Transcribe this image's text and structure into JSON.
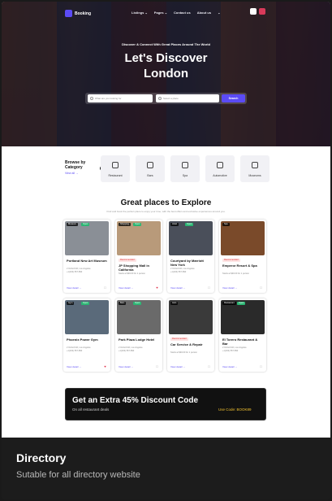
{
  "nav": {
    "logo": "Booking",
    "menu": [
      "Listings ⌄",
      "Pages ⌄",
      "Contact us",
      "About us",
      "⌄"
    ]
  },
  "hero": {
    "subtitle": "Discover & Connect With Great Places Around The World",
    "title_line1": "Let's Discover",
    "title_line2": "London",
    "search_placeholder": "What are you looking for",
    "location_placeholder": "Select a place",
    "search_button": "Search"
  },
  "categories": {
    "title": "Browse by Category",
    "link": "View all →",
    "items": [
      "Restaurant",
      "Bars",
      "Spa",
      "Automotive",
      "Museums"
    ]
  },
  "section": {
    "title": "Great places to Explore",
    "subtitle": "Find and book the perfect place to enjoy your time, with the best offers and exclusive experiences around you."
  },
  "cards": [
    {
      "category": "Museum",
      "status": "Open",
      "recommended": "",
      "name": "Portland New Art Museum",
      "meta1": "2 Oxford Rd, Los Angeles",
      "meta2": "+1(234) 567-890",
      "foot": "View detail →",
      "fav": false,
      "img": "#8a8f96"
    },
    {
      "category": "Shopping",
      "status": "Open",
      "recommended": "Recommended",
      "name": "JP Shopping Mall in California",
      "meta1": "Starts at $49.00 for 1 person",
      "meta2": "",
      "foot": "View detail →",
      "fav": true,
      "img": "#b89a7a"
    },
    {
      "category": "Hotel",
      "status": "Open",
      "recommended": "",
      "name": "Courtyard by Marriott New York",
      "meta1": "2 Oxford Rd, Los Angeles",
      "meta2": "+1(234) 567-890",
      "foot": "View detail →",
      "fav": false,
      "img": "#4a4f5a"
    },
    {
      "category": "Spa",
      "status": "",
      "recommended": "Recommended",
      "name": "Emperor Resort & Spa",
      "meta1": "Starts at $49.00 for 1 person",
      "meta2": "",
      "foot": "View detail →",
      "fav": false,
      "img": "#7a4a2a"
    },
    {
      "category": "Gym",
      "status": "Open",
      "recommended": "",
      "name": "Phoenix Power Gym",
      "meta1": "2 Oxford Rd, Los Angeles",
      "meta2": "+1(234) 567-890",
      "foot": "View detail →",
      "fav": true,
      "img": "#5a6a7a"
    },
    {
      "category": "Bars",
      "status": "Open",
      "recommended": "",
      "name": "Park Plaza Lodge Hotel",
      "meta1": "2 Oxford Rd, Los Angeles",
      "meta2": "+1(234) 567-890",
      "foot": "View detail →",
      "fav": false,
      "img": "#6a6a6a"
    },
    {
      "category": "Auto",
      "status": "",
      "recommended": "Recommended",
      "name": "Car Service & Repair",
      "meta1": "Starts at $49.00 for 1 person",
      "meta2": "",
      "foot": "View detail →",
      "fav": false,
      "img": "#3a3a3a"
    },
    {
      "category": "Restaurant",
      "status": "Open",
      "recommended": "",
      "name": "El Torero Restaurant & Bar",
      "meta1": "2 Oxford Rd, Los Angeles",
      "meta2": "+1(234) 567-890",
      "foot": "View detail →",
      "fav": false,
      "img": "#2a2a2a"
    }
  ],
  "banner": {
    "title": "Get an Extra 45% Discount Code",
    "subtitle": "On all restaurant deals",
    "code": "Use Code: BOOK89"
  },
  "caption": {
    "title": "Directory",
    "subtitle": "Sutable for all directory website"
  },
  "colors": {
    "accent": "#5b4bf5",
    "open": "#2bb673",
    "code": "#f2c230"
  }
}
